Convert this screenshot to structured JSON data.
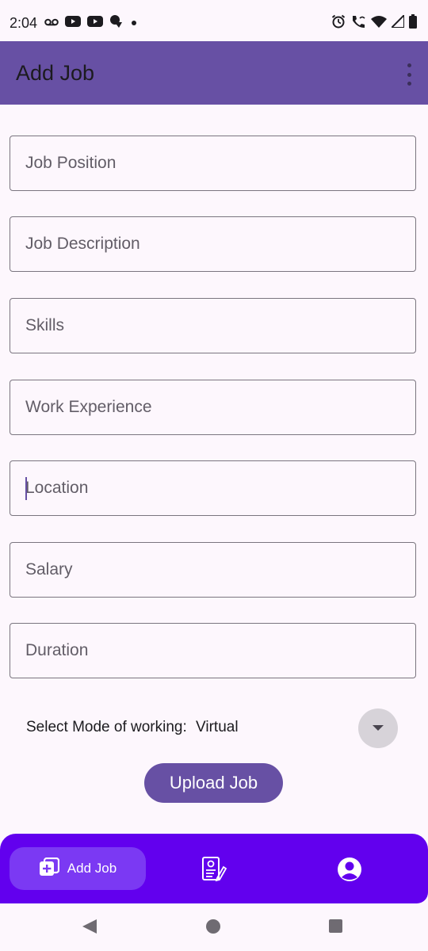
{
  "status_bar": {
    "time": "2:04",
    "left_icons": [
      "voicemail-icon",
      "youtube-icon",
      "youtube-icon",
      "notification-app-icon",
      "dot-icon"
    ],
    "right_icons": [
      "alarm-icon",
      "wifi-calling-icon",
      "wifi-icon",
      "signal-icon",
      "battery-icon"
    ]
  },
  "app_bar": {
    "title": "Add Job",
    "menu_icon": "more-vert-icon",
    "color": "#6750a4"
  },
  "form": {
    "fields": [
      {
        "placeholder": "Job Position",
        "value": ""
      },
      {
        "placeholder": "Job Description",
        "value": ""
      },
      {
        "placeholder": "Skills",
        "value": ""
      },
      {
        "placeholder": "Work Experience",
        "value": ""
      },
      {
        "placeholder": "Location",
        "value": "",
        "focused": true
      },
      {
        "placeholder": "Salary",
        "value": ""
      },
      {
        "placeholder": "Duration",
        "value": ""
      }
    ],
    "mode_label": "Select Mode of working:",
    "mode_value": "Virtual",
    "upload_label": "Upload Job"
  },
  "bottom_nav": {
    "color": "#6200ee",
    "items": [
      {
        "label": "Add Job",
        "icon": "add-job-icon",
        "selected": true
      },
      {
        "label": "",
        "icon": "resume-edit-icon",
        "selected": false
      },
      {
        "label": "",
        "icon": "account-circle-icon",
        "selected": false
      }
    ]
  },
  "system_nav": {
    "icons": [
      "back-icon",
      "home-icon",
      "recents-icon"
    ]
  }
}
